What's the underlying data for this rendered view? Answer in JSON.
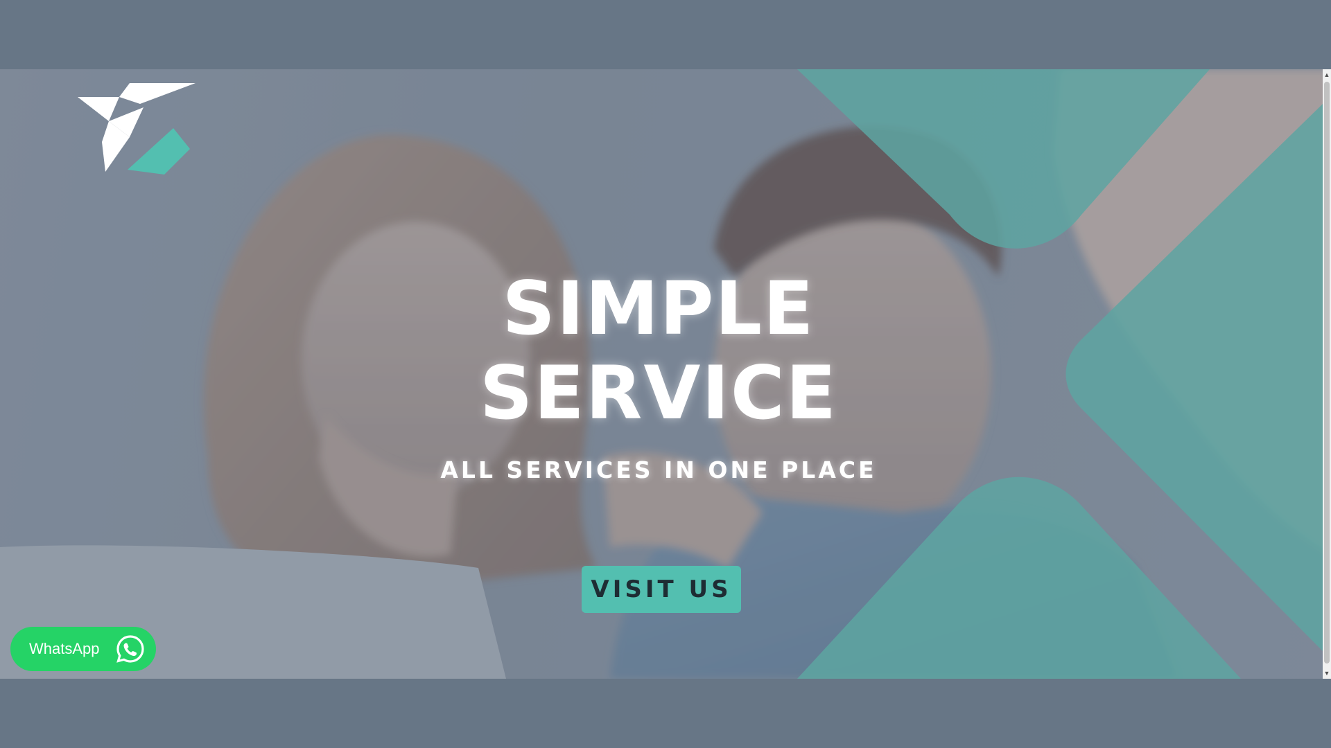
{
  "hero": {
    "title_line1": "SIMPLE",
    "title_line2": "SERVICE",
    "subtitle": "ALL SERVICES IN ONE PLACE",
    "button_label": "VISIT US"
  },
  "whatsapp": {
    "label": "WhatsApp"
  },
  "colors": {
    "accent": "#53bfb0",
    "whatsapp_green": "#25d366",
    "page_background": "#677686"
  },
  "icons": {
    "logo": "origami-bird-logo",
    "whatsapp": "whatsapp-icon",
    "scroll_up": "arrow-up-icon",
    "scroll_down": "arrow-down-icon"
  }
}
